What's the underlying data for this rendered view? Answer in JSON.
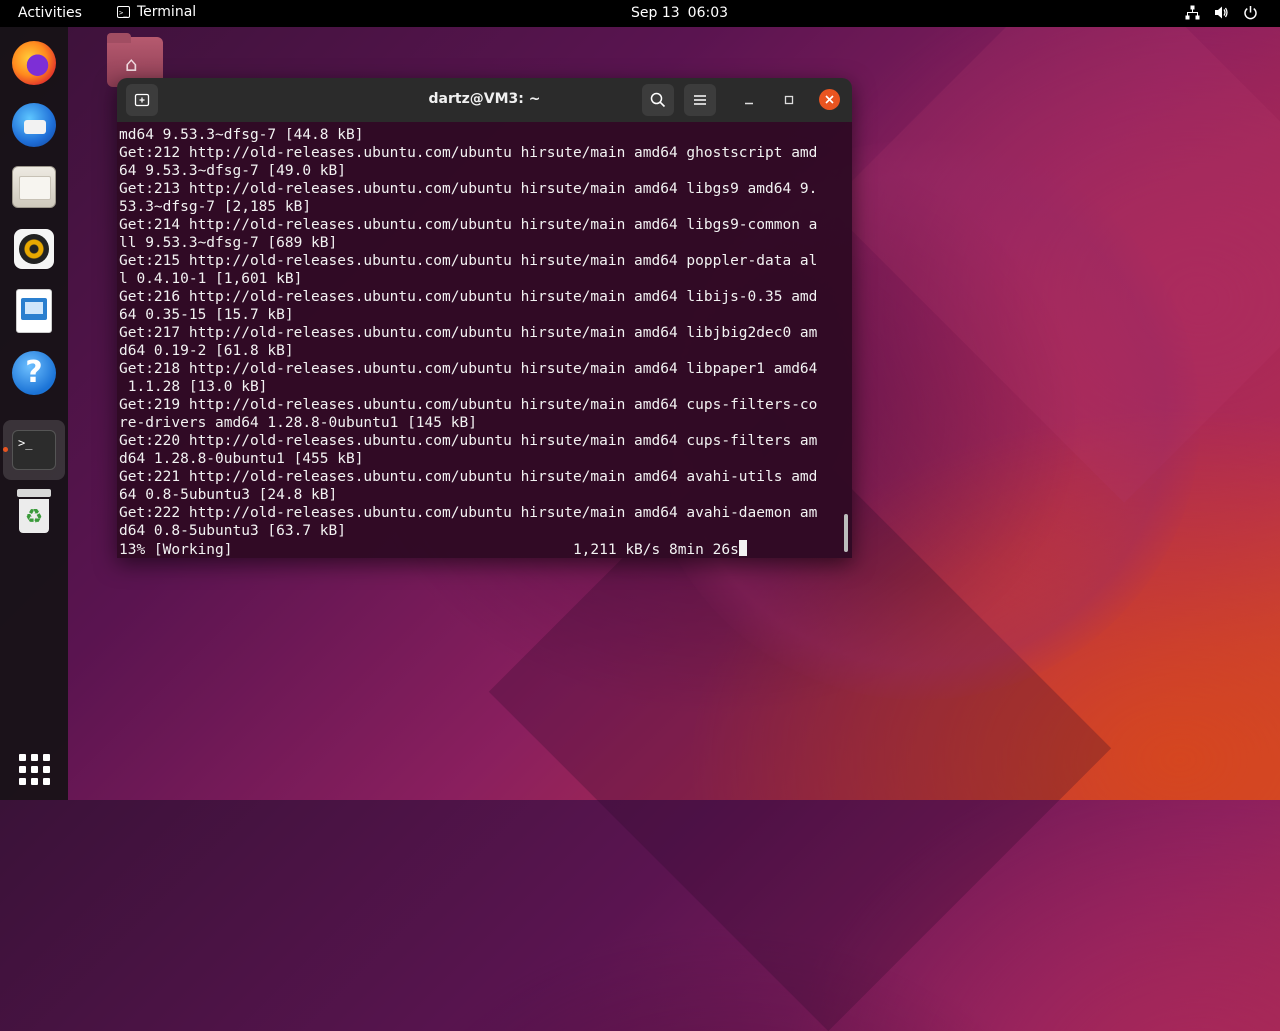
{
  "topbar": {
    "activities": "Activities",
    "app_name": "Terminal",
    "date": "Sep 13",
    "time": "06:03",
    "icons": [
      "network-icon",
      "volume-icon",
      "power-icon"
    ]
  },
  "dock": {
    "items": [
      "firefox-icon",
      "thunderbird-icon",
      "files-icon",
      "rhythmbox-icon",
      "libreoffice-writer-icon",
      "help-icon",
      "terminal-icon",
      "trash-icon"
    ],
    "apps_grid": "show-applications-icon",
    "accent": "#e95420"
  },
  "window": {
    "title": "dartz@VM3: ~",
    "close_color": "#e95420"
  },
  "terminal": {
    "lines": [
      "md64 9.53.3~dfsg-7 [44.8 kB]",
      "Get:212 http://old-releases.ubuntu.com/ubuntu hirsute/main amd64 ghostscript amd",
      "64 9.53.3~dfsg-7 [49.0 kB]",
      "Get:213 http://old-releases.ubuntu.com/ubuntu hirsute/main amd64 libgs9 amd64 9.",
      "53.3~dfsg-7 [2,185 kB]",
      "Get:214 http://old-releases.ubuntu.com/ubuntu hirsute/main amd64 libgs9-common a",
      "ll 9.53.3~dfsg-7 [689 kB]",
      "Get:215 http://old-releases.ubuntu.com/ubuntu hirsute/main amd64 poppler-data al",
      "l 0.4.10-1 [1,601 kB]",
      "Get:216 http://old-releases.ubuntu.com/ubuntu hirsute/main amd64 libijs-0.35 amd",
      "64 0.35-15 [15.7 kB]",
      "Get:217 http://old-releases.ubuntu.com/ubuntu hirsute/main amd64 libjbig2dec0 am",
      "d64 0.19-2 [61.8 kB]",
      "Get:218 http://old-releases.ubuntu.com/ubuntu hirsute/main amd64 libpaper1 amd64",
      " 1.1.28 [13.0 kB]",
      "Get:219 http://old-releases.ubuntu.com/ubuntu hirsute/main amd64 cups-filters-co",
      "re-drivers amd64 1.28.8-0ubuntu1 [145 kB]",
      "Get:220 http://old-releases.ubuntu.com/ubuntu hirsute/main amd64 cups-filters am",
      "d64 1.28.8-0ubuntu1 [455 kB]",
      "Get:221 http://old-releases.ubuntu.com/ubuntu hirsute/main amd64 avahi-utils amd",
      "64 0.8-5ubuntu3 [24.8 kB]",
      "Get:222 http://old-releases.ubuntu.com/ubuntu hirsute/main amd64 avahi-daemon am",
      "d64 0.8-5ubuntu3 [63.7 kB]"
    ],
    "status_line": "13% [Working]                                       1,211 kB/s 8min 26s"
  }
}
